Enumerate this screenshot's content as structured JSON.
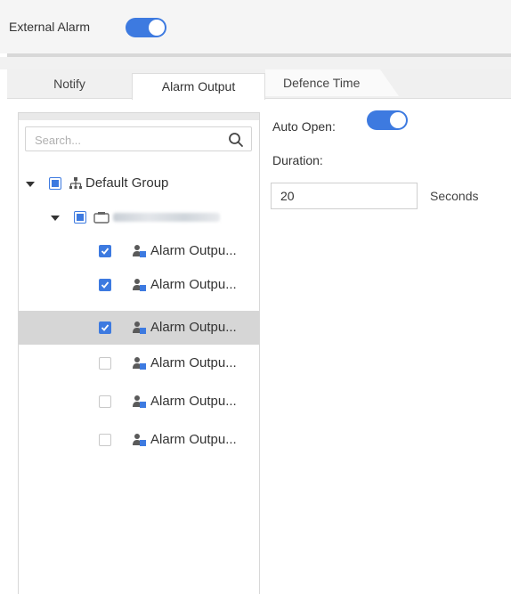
{
  "header": {
    "external_alarm_label": "External Alarm",
    "external_alarm_on": true
  },
  "tabs": [
    {
      "label": "Notify",
      "active": false
    },
    {
      "label": "Alarm Output",
      "active": true
    },
    {
      "label": "Defence Time",
      "active": false
    }
  ],
  "tree": {
    "search_placeholder": "Search...",
    "group": {
      "label": "Default Group",
      "state": "partial",
      "expanded": true
    },
    "device": {
      "state": "partial",
      "expanded": true
    },
    "outputs": [
      {
        "label": "Alarm Outpu...",
        "checked": true,
        "selected": false
      },
      {
        "label": "Alarm Outpu...",
        "checked": true,
        "selected": false
      },
      {
        "label": "Alarm Outpu...",
        "checked": true,
        "selected": true
      },
      {
        "label": "Alarm Outpu...",
        "checked": false,
        "selected": false
      },
      {
        "label": "Alarm Outpu...",
        "checked": false,
        "selected": false
      },
      {
        "label": "Alarm Outpu...",
        "checked": false,
        "selected": false
      }
    ]
  },
  "settings": {
    "auto_open_label": "Auto Open:",
    "auto_open_on": true,
    "duration_label": "Duration:",
    "duration_value": "20",
    "duration_unit": "Seconds"
  },
  "colors": {
    "accent": "#3d7ae0",
    "selected_row": "#d6d6d6"
  }
}
